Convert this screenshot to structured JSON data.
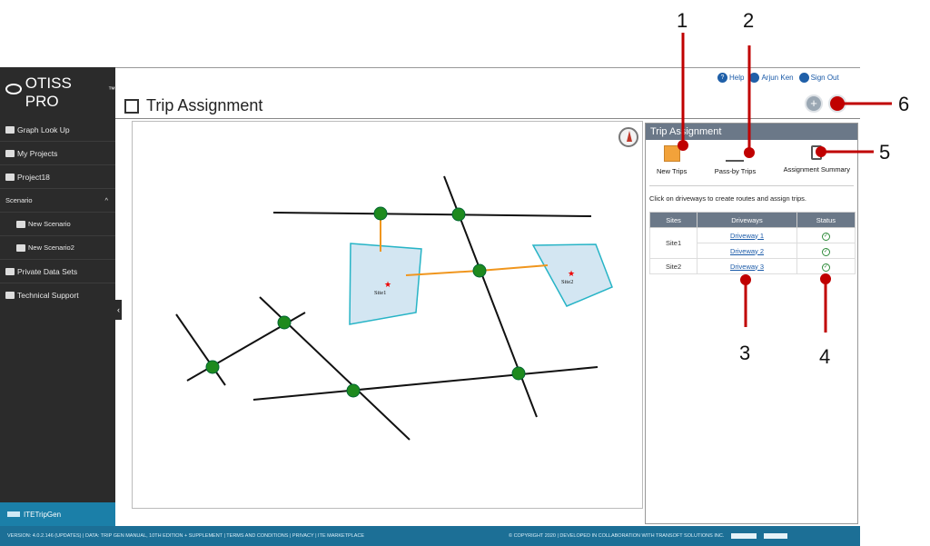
{
  "app": {
    "logo_text": "OTISS PRO",
    "logo_tm": "™"
  },
  "sidebar": {
    "items": [
      {
        "label": "Graph Look Up"
      },
      {
        "label": "My Projects"
      },
      {
        "label": "Project18"
      },
      {
        "label": "Scenario",
        "chevron": "^"
      },
      {
        "label": "New Scenario"
      },
      {
        "label": "New Scenario2"
      },
      {
        "label": "Private Data Sets"
      },
      {
        "label": "Technical Support"
      }
    ],
    "bottom": "ITETripGen",
    "collapse_glyph": "‹"
  },
  "header": {
    "help": "Help",
    "user": "Arjun Ken",
    "signout": "Sign Out",
    "title": "Trip Assignment",
    "add_glyph": "+"
  },
  "map": {
    "site1": "Site1",
    "site2": "Site2"
  },
  "panel": {
    "title": "Trip Assignment",
    "tools": [
      {
        "label": "New Trips"
      },
      {
        "label": "Pass-by Trips"
      },
      {
        "label": "Assignment Summary"
      }
    ],
    "hint": "Click on driveways to create routes and assign trips.",
    "table": {
      "headers": [
        "Sites",
        "Driveways",
        "Status"
      ],
      "site1": "Site1",
      "site2": "Site2",
      "dw1": "Driveway 1",
      "dw2": "Driveway 2",
      "dw3": "Driveway 3"
    }
  },
  "footer": {
    "left": "VERSION: 4.0.2.146 (UPDATES)   |  DATA: TRIP GEN MANUAL, 10TH EDITION + SUPPLEMENT   |  TERMS AND CONDITIONS   |  PRIVACY   |   ITE MARKETPLACE",
    "right": "© COPYRIGHT 2020 | DEVELOPED IN COLLABORATION WITH TRANSOFT SOLUTIONS INC."
  },
  "callouts": [
    "1",
    "2",
    "3",
    "4",
    "5",
    "6"
  ],
  "colors": {
    "sidebar": "#2b2b2b",
    "accent": "#1c6f96",
    "callout": "#c00000",
    "node": "#1e8a1e",
    "site_fill": "#d3e6f2"
  }
}
